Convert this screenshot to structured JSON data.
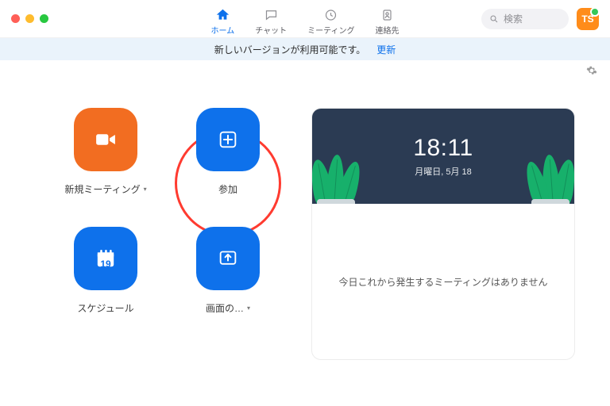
{
  "titlebar": {
    "tabs": {
      "home": {
        "label": "ホーム"
      },
      "chat": {
        "label": "チャット"
      },
      "meetings": {
        "label": "ミーティング"
      },
      "contacts": {
        "label": "連絡先"
      }
    },
    "search_placeholder": "検索",
    "avatar_initials": "TS"
  },
  "banner": {
    "message": "新しいバージョンが利用可能です。",
    "action_label": "更新"
  },
  "actions": {
    "new_meeting": {
      "label": "新規ミーティング"
    },
    "join": {
      "label": "参加"
    },
    "schedule": {
      "label": "スケジュール",
      "day": "19"
    },
    "share": {
      "label": "画面の…"
    }
  },
  "panel": {
    "time": "18:11",
    "date": "月曜日, 5月 18",
    "no_meetings": "今日これから発生するミーティングはありません"
  }
}
